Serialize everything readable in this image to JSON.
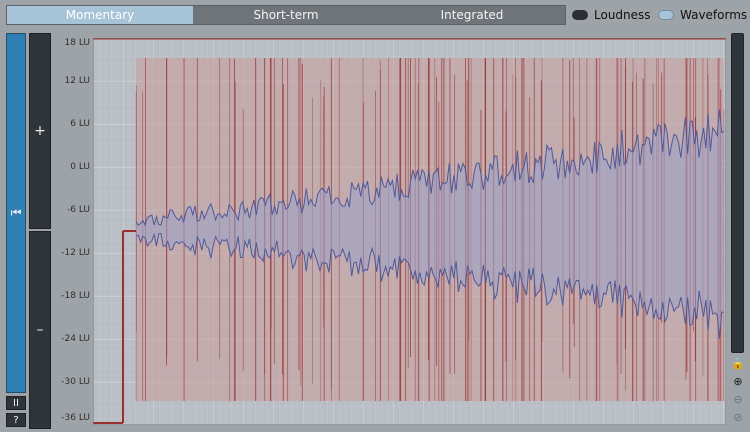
{
  "tabs": {
    "momentary": "Momentary",
    "short_term": "Short-term",
    "integrated": "Integrated"
  },
  "toggles": {
    "loudness": "Loudness",
    "waveforms": "Waveforms"
  },
  "left": {
    "play_icon": "⏮",
    "pause_label": "II",
    "help_label": "?"
  },
  "zoom": {
    "plus": "+",
    "minus": "–"
  },
  "axis": {
    "ticks": [
      "18 LU",
      "12 LU",
      "6 LU",
      "0 LU",
      "-6 LU",
      "-12 LU",
      "-18 LU",
      "-24 LU",
      "-30 LU",
      "-36 LU"
    ]
  },
  "right_tools": {
    "lock_icon": "🔒",
    "zoom_in_icon": "⊕",
    "icon3": "⊖",
    "icon4": "⊘"
  },
  "colors": {
    "accent": "#2f7fb2",
    "tab_active": "#a7c3d8",
    "loudness_line": "#9b2f2f",
    "loudness_fill": "#c99a9a",
    "waveform_line": "#4f5a9a",
    "waveform_fill": "#9aa2c8",
    "grid_bg": "#b9bec4"
  }
}
